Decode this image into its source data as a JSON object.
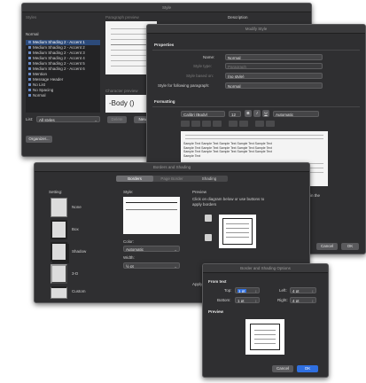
{
  "style_window": {
    "title": "Style",
    "styles_header": "Styles",
    "preview_header": "Paragraph preview",
    "description_header": "Description",
    "normal_label": "Normal",
    "styles": [
      "Medium Shading 2 - Accent 1",
      "Medium Shading 2 - Accent 2",
      "Medium Shading 2 - Accent 3",
      "Medium Shading 2 - Accent 4",
      "Medium Shading 2 - Accent 5",
      "Medium Shading 2 - Accent 6",
      "Mention",
      "Message Header",
      "No List",
      "No Spacing",
      "Normal"
    ],
    "char_preview_header": "Character preview",
    "char_preview_text": "-Body ()",
    "list_label": "List:",
    "list_value": "All styles",
    "organizer_button": "Organizer...",
    "delete_button": "Delete",
    "new_button": "New"
  },
  "modify_window": {
    "title": "Modify Style",
    "properties_header": "Properties",
    "name_label": "Name:",
    "name_value": "Normal",
    "type_label": "Style type:",
    "type_value": "Paragraph",
    "based_label": "Style based on:",
    "based_value": "(no style)",
    "following_label": "Style for following paragraph:",
    "following_value": "Normal",
    "formatting_header": "Formatting",
    "font_value": "Calibri (Body)",
    "size_value": "12",
    "bold": "B",
    "italic": "I",
    "underline": "U",
    "color_value": "Automatic",
    "sample_text": "Sample Text Sample Text Sample Text Sample Text Sample Text Sample Text Sample Text Sample Text Sample Text Sample Text Sample Text Sample Text Sample Text Sample Text Sample Text Sample Text",
    "side_text": "in the",
    "cancel_button": "Cancel",
    "ok_button": "OK"
  },
  "borders_window": {
    "title": "Borders and Shading",
    "tabs": [
      "Borders",
      "Page Border",
      "Shading"
    ],
    "setting_header": "Setting:",
    "settings": [
      "None",
      "Box",
      "Shadow",
      "3-D",
      "Custom"
    ],
    "style_header": "Style:",
    "color_label": "Color:",
    "color_value": "Automatic",
    "width_label": "Width:",
    "width_value": "½ pt",
    "preview_header": "Preview",
    "preview_hint": "Click on diagram below or use buttons to apply borders",
    "apply_label": "Apply"
  },
  "options_window": {
    "title": "Border and Shading Options",
    "from_text_header": "From text",
    "top_label": "Top:",
    "top_value": "1 pt",
    "bottom_label": "Bottom:",
    "bottom_value": "1 pt",
    "left_label": "Left:",
    "left_value": "4 pt",
    "right_label": "Right:",
    "right_value": "4 pt",
    "preview_header": "Preview",
    "cancel_button": "Cancel",
    "ok_button": "OK"
  }
}
